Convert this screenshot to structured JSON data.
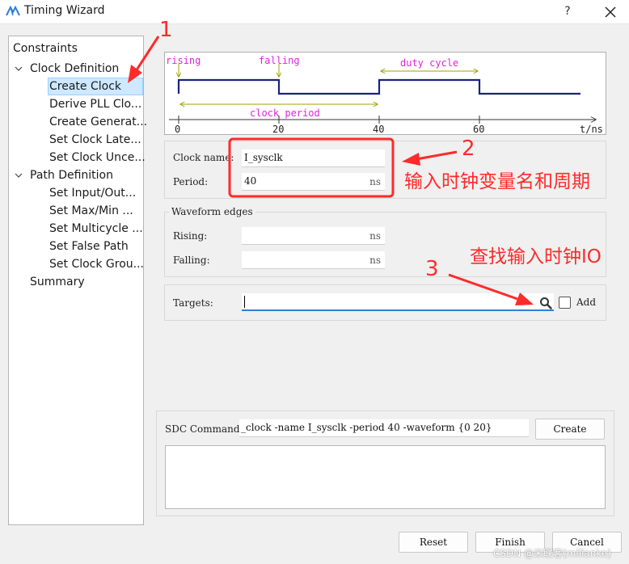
{
  "window": {
    "title": "Timing Wizard",
    "help_label": "?",
    "app_icon": "timing-wizard-icon",
    "close_icon": "close-icon"
  },
  "nav": {
    "root": "Constraints",
    "items": [
      {
        "label": "Clock Definition",
        "expanded": true
      },
      {
        "label": "Create Clock",
        "selected": true
      },
      {
        "label": "Derive PLL Clo..."
      },
      {
        "label": "Create Generat..."
      },
      {
        "label": "Set Clock Late..."
      },
      {
        "label": "Set Clock Unce..."
      },
      {
        "label": "Path Definition",
        "expanded": true
      },
      {
        "label": "Set Input/Out..."
      },
      {
        "label": "Set Max/Min ..."
      },
      {
        "label": "Set Multicycle ..."
      },
      {
        "label": "Set False Path"
      },
      {
        "label": "Set Clock Grou..."
      },
      {
        "label": "Summary"
      }
    ]
  },
  "waveform": {
    "labels": {
      "rising": "rising",
      "falling": "falling",
      "duty_cycle": "duty cycle",
      "clock_period": "clock period",
      "axis_unit": "t/ns"
    },
    "ticks": [
      "0",
      "20",
      "40",
      "60"
    ],
    "colors": {
      "wave": "#1a237e",
      "label": "#e024e0",
      "arrow": "#a0a000"
    }
  },
  "clock": {
    "name_label": "Clock name:",
    "name_value": "I_sysclk",
    "period_label": "Period:",
    "period_value": "40",
    "unit": "ns"
  },
  "waveform_edges": {
    "title": "Waveform edges",
    "rising_label": "Rising:",
    "falling_label": "Falling:",
    "unit": "ns",
    "rising_value": "",
    "falling_value": ""
  },
  "targets": {
    "label": "Targets:",
    "value": "",
    "search_icon": "search-icon",
    "add_label": "Add",
    "add_checked": false
  },
  "sdc": {
    "label": "SDC Command:",
    "value": "_clock -name I_sysclk -period 40 -waveform {0 20}",
    "create_button": "Create",
    "output": ""
  },
  "footer": {
    "reset": "Reset",
    "finish": "Finish",
    "cancel": "Cancel"
  },
  "annotations": {
    "color": "#ff2a2a",
    "n1": "1",
    "n2": "2",
    "n3": "3",
    "text2": "输入时钟变量名和周期",
    "text3": "查找输入时钟IO"
  },
  "watermark": "CSDN @米联客(milianke)"
}
